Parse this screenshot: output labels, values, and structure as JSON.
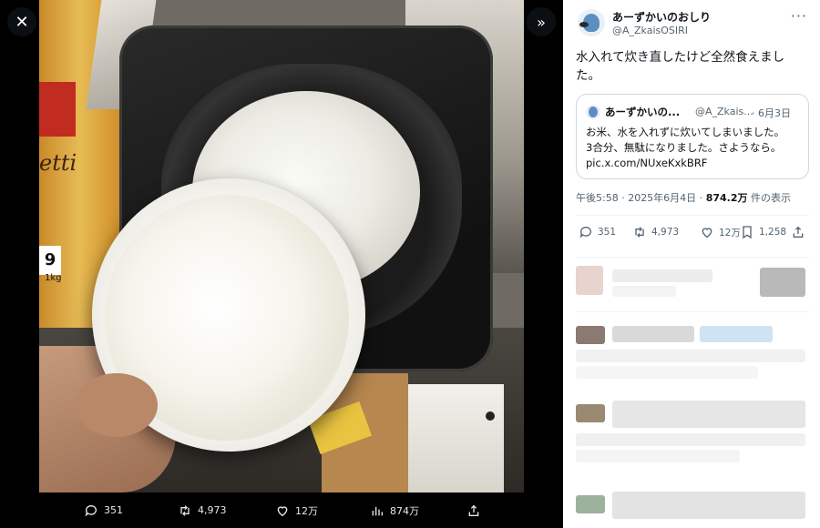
{
  "viewer": {
    "photo_texts": {
      "pasta_label": "etti",
      "pasta_price": "9",
      "pasta_weight": "1kg"
    },
    "close_glyph": "✕",
    "expand_glyph": "»",
    "actions": [
      {
        "name": "reply",
        "icon": "reply-icon",
        "count": "351"
      },
      {
        "name": "retweet",
        "icon": "retweet-icon",
        "count": "4,973"
      },
      {
        "name": "like",
        "icon": "heart-icon",
        "count": "12万"
      },
      {
        "name": "views",
        "icon": "views-icon",
        "count": "874万"
      }
    ]
  },
  "tweet": {
    "display_name": "あーずかいのおしり",
    "handle": "@A_ZkaisOSIRI",
    "more": "···",
    "text": "水入れて炊き直したけど全然食えました。",
    "quote": {
      "display_name": "あーずかいの...",
      "handle": "@A_Zkais...",
      "date": "· 6月3日",
      "body_line1": "お米、水を入れずに炊いてしまいました。",
      "body_line2": "3合分、無駄になりました。さようなら。",
      "link": "pic.x.com/NUxeKxkBRF"
    },
    "timestamp": "午後5:58 · 2025年6月4日 · ",
    "views_count": "874.2万",
    "views_label": " 件の表示",
    "stats": {
      "replies": "351",
      "retweets": "4,973",
      "likes": "12万",
      "bookmarks": "1,258"
    }
  },
  "colors": {
    "panel_bg": "#ffffff",
    "text_primary": "#0f1419",
    "text_secondary": "#536471",
    "border": "#cfd9de",
    "viewer_bg": "#000000"
  }
}
